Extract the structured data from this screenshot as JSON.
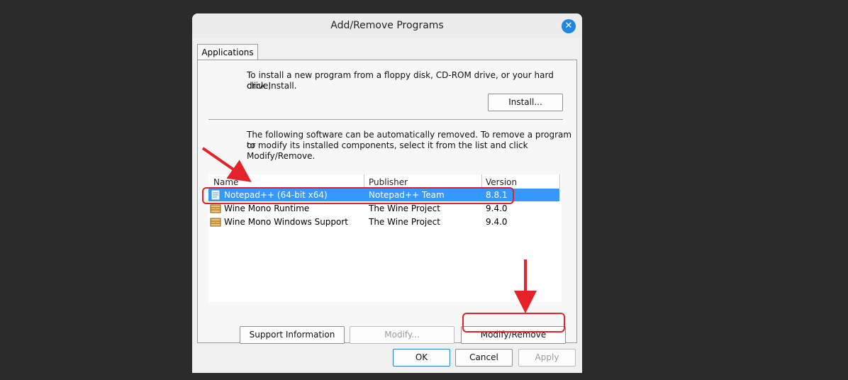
{
  "dialog": {
    "title": "Add/Remove Programs",
    "close_icon": "close-icon"
  },
  "tabs": [
    {
      "label": "Applications"
    }
  ],
  "install_section": {
    "text_line1": "To install a new program from a floppy disk, CD-ROM drive, or your hard drive,",
    "text_line2": "click Install.",
    "install_button": "Install..."
  },
  "remove_section": {
    "text_line1": "The following software can be automatically removed. To remove a program or",
    "text_line2": "to modify its installed components, select it from the list and click",
    "text_line3": "Modify/Remove."
  },
  "list": {
    "columns": [
      "Name",
      "Publisher",
      "Version"
    ],
    "rows": [
      {
        "name": "Notepad++ (64-bit x64)",
        "publisher": "Notepad++ Team",
        "version": "8.8.1",
        "icon": "notepad-icon",
        "selected": true
      },
      {
        "name": "Wine Mono Runtime",
        "publisher": "The Wine Project",
        "version": "9.4.0",
        "icon": "package-icon",
        "selected": false
      },
      {
        "name": "Wine Mono Windows Support",
        "publisher": "The Wine Project",
        "version": "9.4.0",
        "icon": "package-icon",
        "selected": false
      }
    ]
  },
  "action_buttons": {
    "support": "Support Information",
    "modify": "Modify...",
    "modify_remove": "Modify/Remove"
  },
  "footer_buttons": {
    "ok": "OK",
    "cancel": "Cancel",
    "apply": "Apply"
  },
  "colors": {
    "selection": "#3399ff",
    "annotation": "#e5212a",
    "close_button": "#1f87e0"
  }
}
